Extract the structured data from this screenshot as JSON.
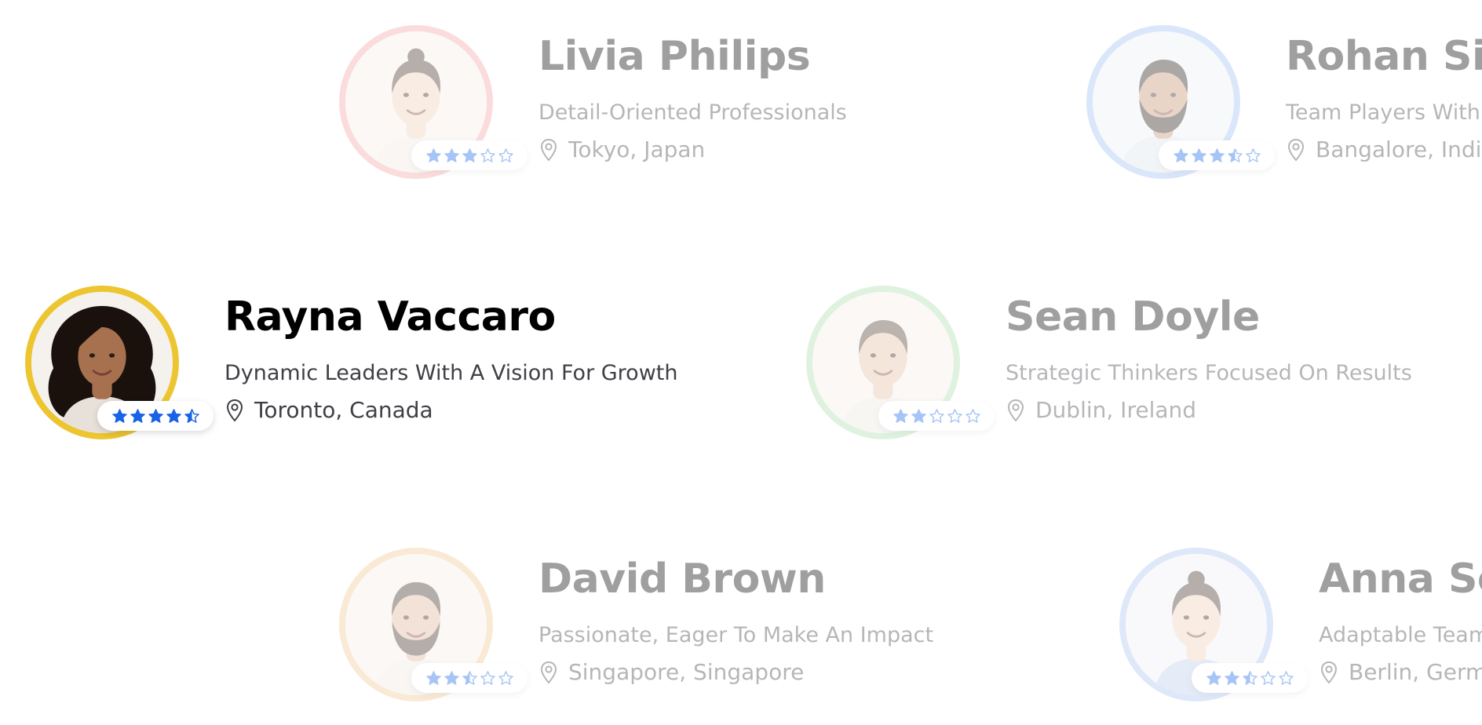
{
  "people": [
    {
      "name": "Livia Philips",
      "subtitle": "Detail-Oriented Professionals",
      "location": "Tokyo, Japan",
      "rating": 3,
      "ring_color": "#f4a3a3",
      "dimmed": true,
      "avatar": {
        "bg": "#f6ece6",
        "skin": "#efcfb6",
        "hair": "#3b2a22",
        "shirt": "#efe7e0",
        "beard": false,
        "long_hair": false,
        "bun": true
      }
    },
    {
      "name": "Rohan Singh",
      "subtitle": "Team Players With",
      "location": "Bangalore, India",
      "rating": 3.5,
      "ring_color": "#9cbef2",
      "dimmed": true,
      "avatar": {
        "bg": "#e9eef4",
        "skin": "#c48e6e",
        "hair": "#20160f",
        "shirt": "#dde3ea",
        "beard": true,
        "long_hair": false,
        "bun": false
      }
    },
    {
      "name": "Rayna Vaccaro",
      "subtitle": "Dynamic Leaders With A Vision For Growth",
      "location": "Toronto, Canada",
      "rating": 4.5,
      "ring_color": "#ecc531",
      "dimmed": false,
      "avatar": {
        "bg": "#f5f2ee",
        "skin": "#a7704f",
        "hair": "#1a110c",
        "shirt": "#e8e1da",
        "beard": false,
        "long_hair": true,
        "bun": false
      }
    },
    {
      "name": "Sean Doyle",
      "subtitle": "Strategic Thinkers Focused On Results",
      "location": "Dublin, Ireland",
      "rating": 2,
      "ring_color": "#a9dca9",
      "dimmed": true,
      "avatar": {
        "bg": "#f3ebe4",
        "skin": "#e4bea1",
        "hair": "#4a3526",
        "shirt": "#ece6df",
        "beard": false,
        "long_hair": false,
        "bun": false
      }
    },
    {
      "name": "David Brown",
      "subtitle": "Passionate, Eager To Make An Impact",
      "location": "Singapore, Singapore",
      "rating": 2.5,
      "ring_color": "#f2c48c",
      "dimmed": true,
      "avatar": {
        "bg": "#f6ece5",
        "skin": "#dfb394",
        "hair": "#3a2a1f",
        "shirt": "#eee7e0",
        "beard": true,
        "long_hair": false,
        "bun": false
      }
    },
    {
      "name": "Anna Schmidt",
      "subtitle": "Adaptable Team",
      "location": "Berlin, Germany",
      "rating": 2.5,
      "ring_color": "#a7c3f0",
      "dimmed": true,
      "avatar": {
        "bg": "#eef0f3",
        "skin": "#ecccb5",
        "hair": "#3c2a20",
        "shirt": "#b9c9ea",
        "beard": false,
        "long_hair": false,
        "bun": true
      }
    }
  ],
  "colors": {
    "star": "#1762e6",
    "star_empty": "#1762e6",
    "name": "#000000",
    "text": "#3f3f46"
  },
  "icons": {
    "location": "map-pin-icon",
    "rating": "star-icon"
  }
}
